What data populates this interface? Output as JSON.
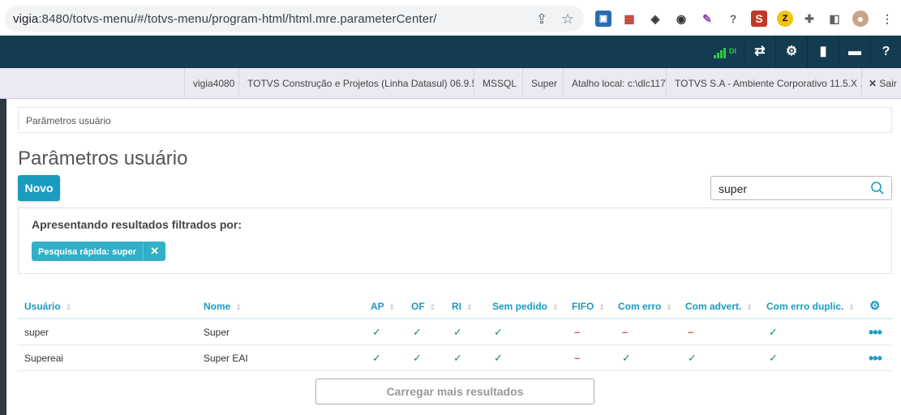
{
  "browser": {
    "url_host": "vigia",
    "url_rest": ":8480/totvs-menu/#/totvs-menu/program-html/html.mre.parameterCenter/"
  },
  "topbar": {
    "network_label": "DI",
    "icons": [
      "shuffle-icon",
      "gear-icon",
      "document-icon",
      "chat-icon",
      "help-icon"
    ]
  },
  "infobar": {
    "items": [
      "vigia4080",
      "TOTVS Construção e Projetos (Linha Datasul) 06.9.5...",
      "MSSQL",
      "Super",
      "Atalho local: c:\\dlc117",
      "TOTVS S.A - Ambiente Corporativo 11.5.X ..."
    ],
    "exit_label": "Sair"
  },
  "breadcrumb": "Parâmetros usuário",
  "page_title": "Parâmetros usuário",
  "new_button": "Novo",
  "search": {
    "value": "super"
  },
  "filter": {
    "title": "Apresentando resultados filtrados por:",
    "chip": "Pesquisa rápida: super"
  },
  "table": {
    "headers": [
      "Usuário",
      "Nome",
      "AP",
      "OF",
      "RI",
      "Sem pedido",
      "FIFO",
      "Com erro",
      "Com advert.",
      "Com erro duplic."
    ],
    "rows": [
      {
        "usuario": "super",
        "nome": "Super",
        "flags": [
          true,
          true,
          true,
          true,
          false,
          false,
          false,
          true
        ]
      },
      {
        "usuario": "Supereai",
        "nome": "Super EAI",
        "flags": [
          true,
          true,
          true,
          true,
          false,
          true,
          true,
          true
        ]
      }
    ]
  },
  "load_more": "Carregar mais resultados",
  "colors": {
    "primary": "#1a9bc0",
    "topbar": "#143c50",
    "check": "#1a8a5a",
    "dash": "#d9534f"
  }
}
